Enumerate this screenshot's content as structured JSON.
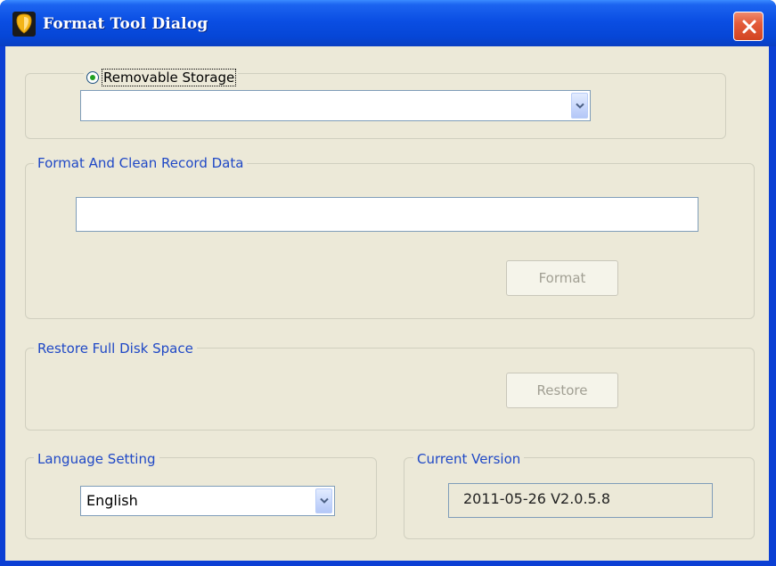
{
  "window": {
    "title": "Format Tool Dialog"
  },
  "storage": {
    "radio_label": "Removable Storage",
    "selected": true,
    "drive_value": ""
  },
  "format_group": {
    "label": "Format And Clean Record Data",
    "field_value": "",
    "button_label": "Format"
  },
  "restore_group": {
    "label": "Restore Full Disk Space",
    "button_label": "Restore"
  },
  "language": {
    "label": "Language Setting",
    "selected": "English"
  },
  "version": {
    "label": "Current Version",
    "value": "2011-05-26 V2.0.5.8"
  },
  "colors": {
    "title_bar": "#0a4ee3",
    "group_label": "#1f48c6",
    "client_bg": "#ece9d8",
    "close_button": "#e35b3a"
  },
  "icons": {
    "app": "app-shield-icon",
    "close": "close-x-icon",
    "dropdown": "chevron-down-icon"
  }
}
